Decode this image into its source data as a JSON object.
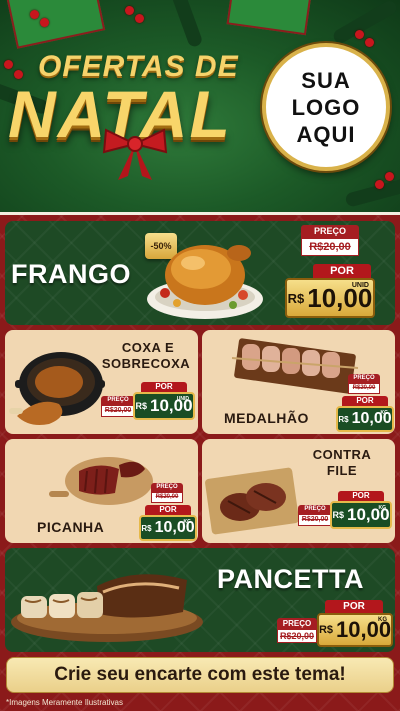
{
  "header": {
    "title_top": "OFERTAS DE",
    "title_main": "NATAL",
    "logo_lines": [
      "SUA",
      "LOGO",
      "AQUI"
    ]
  },
  "products": {
    "frango": {
      "name": "FRANGO",
      "badge": "-50%",
      "preco_label": "PREÇO",
      "old": "R$20,00",
      "por_label": "POR",
      "currency": "R$",
      "price": "10,00",
      "unit": "UNID"
    },
    "coxa": {
      "name_line1": "COXA E",
      "name_line2": "SOBRECOXA",
      "preco_label": "PREÇO",
      "old": "R$20,00",
      "por_label": "POR",
      "currency": "R$",
      "price": "10,00",
      "unit": "UNID"
    },
    "medalhao": {
      "name": "MEDALHÃO",
      "preco_label": "PREÇO",
      "old": "R$20,00",
      "por_label": "POR",
      "currency": "R$",
      "price": "10,00",
      "unit": "KG"
    },
    "picanha": {
      "name": "PICANHA",
      "preco_label": "PREÇO",
      "old": "R$20,00",
      "por_label": "POR",
      "currency": "R$",
      "price": "10,00",
      "unit": "KG"
    },
    "contrafile": {
      "name_line1": "CONTRA",
      "name_line2": "FILE",
      "preco_label": "PREÇO",
      "old": "R$20,00",
      "por_label": "POR",
      "currency": "R$",
      "price": "10,00",
      "unit": "KG"
    },
    "pancetta": {
      "name": "PANCETTA",
      "preco_label": "PREÇO",
      "old": "R$20,00",
      "por_label": "POR",
      "currency": "R$",
      "price": "10,00",
      "unit": "KG"
    }
  },
  "cta": "Crie seu encarte com este tema!",
  "disclaimer": "*Imagens Meramente Ilustrativas",
  "colors": {
    "green_panel": "#1e4a25",
    "red_bg": "#8b1a1a",
    "gold": "#e6b94a",
    "beige_panel": "#f1d7b2"
  },
  "icons": [
    "red-bow-icon",
    "roast-chicken-image",
    "chicken-thigh-pan-image",
    "bacon-skewers-image",
    "picanha-board-image",
    "steak-tray-image",
    "pancetta-roast-image"
  ]
}
